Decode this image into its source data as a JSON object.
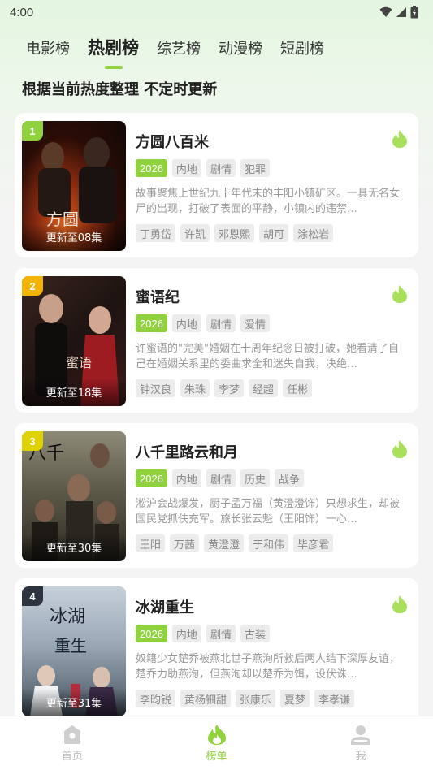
{
  "status": {
    "time": "4:00"
  },
  "tabs": [
    {
      "label": "电影榜"
    },
    {
      "label": "热剧榜",
      "active": true
    },
    {
      "label": "综艺榜"
    },
    {
      "label": "动漫榜"
    },
    {
      "label": "短剧榜"
    }
  ],
  "subtitle": "根据当前热度整理 不定时更新",
  "accent_color": "#8fd23e",
  "items": [
    {
      "rank": "1",
      "rank_color": "#8fd23e",
      "title": "方圆八百米",
      "update": "更新至08集",
      "year": "2026",
      "tags": [
        "内地",
        "剧情",
        "犯罪"
      ],
      "desc": "故事聚焦上世纪九十年代末的丰阳小镇矿区。一具无名女尸的出现，打破了表面的平静，小镇内的违禁…",
      "cast": [
        "丁勇岱",
        "许凯",
        "邓恩熙",
        "胡可",
        "涂松岩"
      ]
    },
    {
      "rank": "2",
      "rank_color": "#f2b400",
      "title": "蜜语纪",
      "update": "更新至18集",
      "year": "2026",
      "tags": [
        "内地",
        "剧情",
        "爱情"
      ],
      "desc": "许蜜语的\"完美\"婚姻在十周年纪念日被打破，她看清了自己在婚姻关系里的委曲求全和迷失自我，决绝…",
      "cast": [
        "钟汉良",
        "朱珠",
        "李梦",
        "经超",
        "任彬"
      ]
    },
    {
      "rank": "3",
      "rank_color": "#e0d100",
      "title": "八千里路云和月",
      "update": "更新至30集",
      "year": "2026",
      "tags": [
        "内地",
        "剧情",
        "历史",
        "战争"
      ],
      "desc": "淞沪会战爆发，厨子孟万福（黄澄澄饰）只想求生，却被国民党抓伕充军。旅长张云魁（王阳饰）一心…",
      "cast": [
        "王阳",
        "万茜",
        "黄澄澄",
        "于和伟",
        "毕彦君"
      ]
    },
    {
      "rank": "4",
      "rank_color": "#2d3440",
      "title": "冰湖重生",
      "update": "更新至31集",
      "year": "2026",
      "tags": [
        "内地",
        "剧情",
        "古装"
      ],
      "desc": "奴籍少女楚乔被燕北世子燕洵所救后两人结下深厚友谊，楚乔力助燕洵，但燕洵却以楚乔为饵，设伏诛…",
      "cast": [
        "李昀锐",
        "黄杨钿甜",
        "张康乐",
        "夏梦",
        "李孝谦"
      ]
    }
  ],
  "nav": [
    {
      "label": "首页",
      "icon": "home-icon"
    },
    {
      "label": "榜单",
      "icon": "flame-icon",
      "active": true
    },
    {
      "label": "我",
      "icon": "user-icon"
    }
  ]
}
